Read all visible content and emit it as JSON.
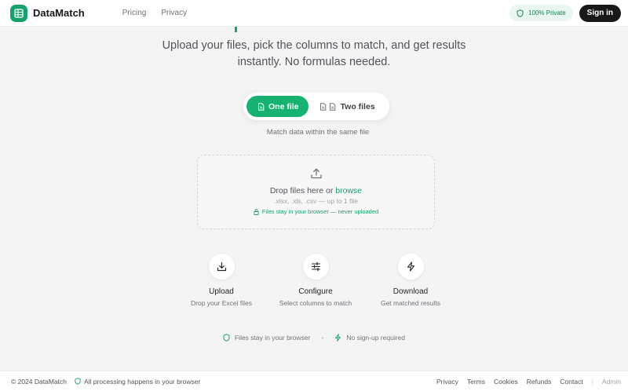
{
  "header": {
    "brand": "DataMatch",
    "nav": [
      "Pricing",
      "Privacy"
    ],
    "badge": "100% Private",
    "signin": "Sign in"
  },
  "hero": {
    "subtitle": "Upload your files, pick the columns to match, and get results instantly. No formulas needed."
  },
  "mode_toggle": {
    "options": [
      "One file",
      "Two files"
    ],
    "selected": "One file",
    "description": "Match data within the same file"
  },
  "dropzone": {
    "text": "Drop files here or",
    "link": "browse",
    "types": ".xlsx, .xls, .csv — up to 1 file",
    "privacy_note": "Files stay in your browser — never uploaded"
  },
  "steps": [
    {
      "title": "Upload",
      "desc": "Drop your Excel files",
      "icon": "download-icon"
    },
    {
      "title": "Configure",
      "desc": "Select columns to match",
      "icon": "sliders-icon"
    },
    {
      "title": "Download",
      "desc": "Get matched results",
      "icon": "lightning-icon"
    }
  ],
  "trust": [
    "Files stay in your browser",
    "No sign-up required"
  ],
  "footer": {
    "copyright": "© 2024 DataMatch",
    "note": "All processing happens in your browser",
    "links": [
      "Privacy",
      "Terms",
      "Cookies",
      "Refunds",
      "Contact"
    ],
    "admin": "Admin"
  },
  "colors": {
    "accent": "#16a36b",
    "toggle_active": "#16b26f",
    "background": "#f4f4f5",
    "dark": "#18181b"
  }
}
